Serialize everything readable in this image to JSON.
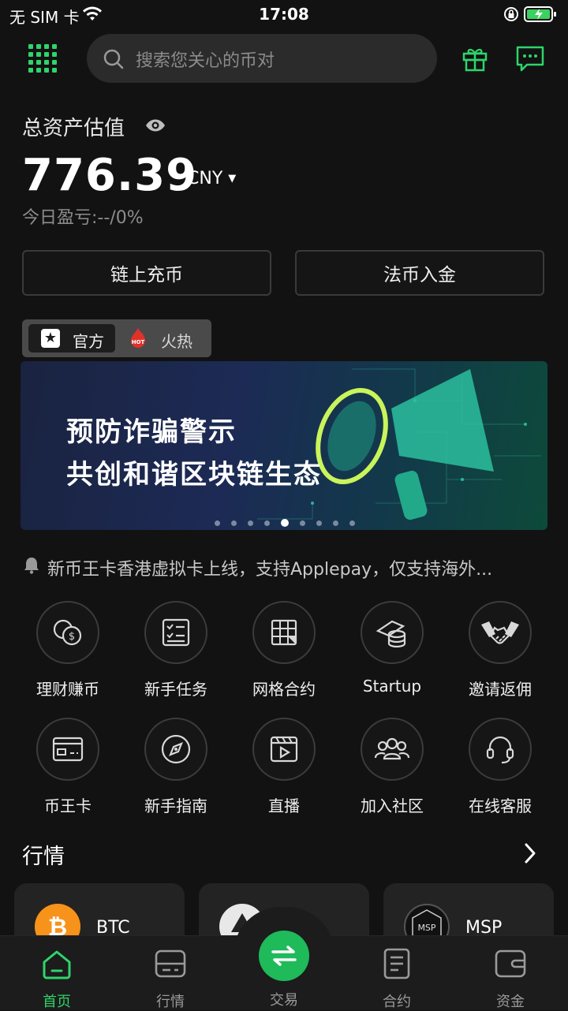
{
  "status_bar": {
    "carrier": "无 SIM 卡",
    "time": "17:08"
  },
  "search": {
    "placeholder": "搜索您关心的币对"
  },
  "assets": {
    "title": "总资产估值",
    "value": "776.39",
    "currency": "CNY",
    "pnl": "今日盈亏:--/0%"
  },
  "actions": {
    "deposit": "链上充币",
    "fiat": "法币入金"
  },
  "tabs": {
    "official": "官方",
    "hot": "火热",
    "hot_badge": "HOT"
  },
  "banner": {
    "line1": "预防诈骗警示",
    "line2": "共创和谐区块链生态",
    "active_dot": 5,
    "dot_count": 9
  },
  "notice": "新币王卡香港虚拟卡上线，支持Applepay，仅支持海外...",
  "shortcuts": [
    {
      "label": "理财赚币",
      "icon": "coins-icon"
    },
    {
      "label": "新手任务",
      "icon": "checklist-icon"
    },
    {
      "label": "网格合约",
      "icon": "grid-contract-icon"
    },
    {
      "label": "Startup",
      "icon": "startup-stack-icon"
    },
    {
      "label": "邀请返佣",
      "icon": "handshake-icon"
    },
    {
      "label": "币王卡",
      "icon": "card-icon"
    },
    {
      "label": "新手指南",
      "icon": "compass-icon"
    },
    {
      "label": "直播",
      "icon": "live-play-icon"
    },
    {
      "label": "加入社区",
      "icon": "community-icon"
    },
    {
      "label": "在线客服",
      "icon": "headset-icon"
    }
  ],
  "market": {
    "title": "行情",
    "cards": [
      {
        "name": "BTC",
        "color": "#f7931a"
      },
      {
        "name": "",
        "color": "#e8e8e8"
      },
      {
        "name": "MSP",
        "color": "#111111"
      }
    ]
  },
  "nav": [
    {
      "label": "首页",
      "active": true
    },
    {
      "label": "行情",
      "active": false
    },
    {
      "label": "交易",
      "active": false
    },
    {
      "label": "合约",
      "active": false
    },
    {
      "label": "资金",
      "active": false
    }
  ],
  "colors": {
    "accent": "#2fd46a",
    "background": "#121212"
  }
}
